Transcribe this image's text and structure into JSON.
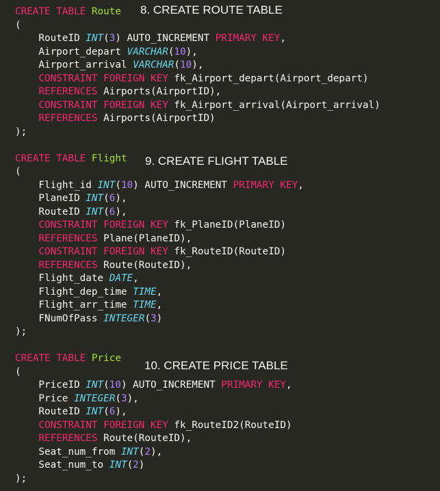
{
  "headings": [
    "8. CREATE ROUTE TABLE",
    "9. CREATE FLIGHT TABLE",
    "10. CREATE PRICE TABLE"
  ],
  "colors": {
    "background": "#272822",
    "keyword": "#f92672",
    "table_name": "#a6e22e",
    "type": "#66d9ef",
    "number": "#ae81ff",
    "text": "#f8f8f2"
  },
  "lines": [
    [
      [
        "kw",
        "CREATE TABLE "
      ],
      [
        "tn",
        "Route"
      ]
    ],
    [
      [
        "pl",
        "("
      ]
    ],
    [
      [
        "pl",
        "    RouteID "
      ],
      [
        "ty",
        "INT"
      ],
      [
        "pl",
        "("
      ],
      [
        "nm",
        "3"
      ],
      [
        "pl",
        ") AUTO_INCREMENT "
      ],
      [
        "kw",
        "PRIMARY KEY"
      ],
      [
        "pl",
        ","
      ]
    ],
    [
      [
        "pl",
        "    Airport_depart "
      ],
      [
        "ty",
        "VARCHAR"
      ],
      [
        "pl",
        "("
      ],
      [
        "nm",
        "10"
      ],
      [
        "pl",
        "),"
      ]
    ],
    [
      [
        "pl",
        "    Airport_arrival "
      ],
      [
        "ty",
        "VARCHAR"
      ],
      [
        "pl",
        "("
      ],
      [
        "nm",
        "10"
      ],
      [
        "pl",
        "),"
      ]
    ],
    [
      [
        "pl",
        "    "
      ],
      [
        "kw",
        "CONSTRAINT FOREIGN KEY"
      ],
      [
        "pl",
        " fk_Airport_depart(Airport_depart)"
      ]
    ],
    [
      [
        "pl",
        "    "
      ],
      [
        "kw",
        "REFERENCES"
      ],
      [
        "pl",
        " Airports(AirportID),"
      ]
    ],
    [
      [
        "pl",
        "    "
      ],
      [
        "kw",
        "CONSTRAINT FOREIGN KEY"
      ],
      [
        "pl",
        " fk_Airport_arrival(Airport_arrival)"
      ]
    ],
    [
      [
        "pl",
        "    "
      ],
      [
        "kw",
        "REFERENCES"
      ],
      [
        "pl",
        " Airports(AirportID)"
      ]
    ],
    [
      [
        "pl",
        ");"
      ]
    ],
    [],
    [
      [
        "kw",
        "CREATE TABLE "
      ],
      [
        "tn",
        "Flight"
      ]
    ],
    [
      [
        "pl",
        "("
      ]
    ],
    [
      [
        "pl",
        "    Flight_id "
      ],
      [
        "ty",
        "INT"
      ],
      [
        "pl",
        "("
      ],
      [
        "nm",
        "10"
      ],
      [
        "pl",
        ") AUTO_INCREMENT "
      ],
      [
        "kw",
        "PRIMARY KEY"
      ],
      [
        "pl",
        ","
      ]
    ],
    [
      [
        "pl",
        "    PlaneID "
      ],
      [
        "ty",
        "INT"
      ],
      [
        "pl",
        "("
      ],
      [
        "nm",
        "6"
      ],
      [
        "pl",
        "),"
      ]
    ],
    [
      [
        "pl",
        "    RouteID "
      ],
      [
        "ty",
        "INT"
      ],
      [
        "pl",
        "("
      ],
      [
        "nm",
        "6"
      ],
      [
        "pl",
        "),"
      ]
    ],
    [
      [
        "pl",
        "    "
      ],
      [
        "kw",
        "CONSTRAINT FOREIGN KEY"
      ],
      [
        "pl",
        " fk_PlaneID(PlaneID)"
      ]
    ],
    [
      [
        "pl",
        "    "
      ],
      [
        "kw",
        "REFERENCES"
      ],
      [
        "pl",
        " Plane(PlaneID),"
      ]
    ],
    [
      [
        "pl",
        "    "
      ],
      [
        "kw",
        "CONSTRAINT FOREIGN KEY"
      ],
      [
        "pl",
        " fk_RouteID(RouteID)"
      ]
    ],
    [
      [
        "pl",
        "    "
      ],
      [
        "kw",
        "REFERENCES"
      ],
      [
        "pl",
        " Route(RouteID),"
      ]
    ],
    [
      [
        "pl",
        "    Flight_date "
      ],
      [
        "ty",
        "DATE"
      ],
      [
        "pl",
        ","
      ]
    ],
    [
      [
        "pl",
        "    Flight_dep_time "
      ],
      [
        "ty",
        "TIME"
      ],
      [
        "pl",
        ","
      ]
    ],
    [
      [
        "pl",
        "    Flight_arr_time "
      ],
      [
        "ty",
        "TIME"
      ],
      [
        "pl",
        ","
      ]
    ],
    [
      [
        "pl",
        "    FNumOfPass "
      ],
      [
        "ty",
        "INTEGER"
      ],
      [
        "pl",
        "("
      ],
      [
        "nm",
        "3"
      ],
      [
        "pl",
        ")"
      ]
    ],
    [
      [
        "pl",
        ");"
      ]
    ],
    [],
    [
      [
        "kw",
        "CREATE TABLE "
      ],
      [
        "tn",
        "Price"
      ]
    ],
    [
      [
        "pl",
        "("
      ]
    ],
    [
      [
        "pl",
        "    PriceID "
      ],
      [
        "ty",
        "INT"
      ],
      [
        "pl",
        "("
      ],
      [
        "nm",
        "10"
      ],
      [
        "pl",
        ") AUTO_INCREMENT "
      ],
      [
        "kw",
        "PRIMARY KEY"
      ],
      [
        "pl",
        ","
      ]
    ],
    [
      [
        "pl",
        "    Price "
      ],
      [
        "ty",
        "INTEGER"
      ],
      [
        "pl",
        "("
      ],
      [
        "nm",
        "3"
      ],
      [
        "pl",
        "),"
      ]
    ],
    [
      [
        "pl",
        "    RouteID "
      ],
      [
        "ty",
        "INT"
      ],
      [
        "pl",
        "("
      ],
      [
        "nm",
        "6"
      ],
      [
        "pl",
        "),"
      ]
    ],
    [
      [
        "pl",
        "    "
      ],
      [
        "kw",
        "CONSTRAINT FOREIGN KEY"
      ],
      [
        "pl",
        " fk_RouteID2(RouteID)"
      ]
    ],
    [
      [
        "pl",
        "    "
      ],
      [
        "kw",
        "REFERENCES"
      ],
      [
        "pl",
        " Route(RouteID),"
      ]
    ],
    [
      [
        "pl",
        "    Seat_num_from "
      ],
      [
        "ty",
        "INT"
      ],
      [
        "pl",
        "("
      ],
      [
        "nm",
        "2"
      ],
      [
        "pl",
        "),"
      ]
    ],
    [
      [
        "pl",
        "    Seat_num_to "
      ],
      [
        "ty",
        "INT"
      ],
      [
        "pl",
        "("
      ],
      [
        "nm",
        "2"
      ],
      [
        "pl",
        ")"
      ]
    ],
    [
      [
        "pl",
        ");"
      ]
    ]
  ]
}
